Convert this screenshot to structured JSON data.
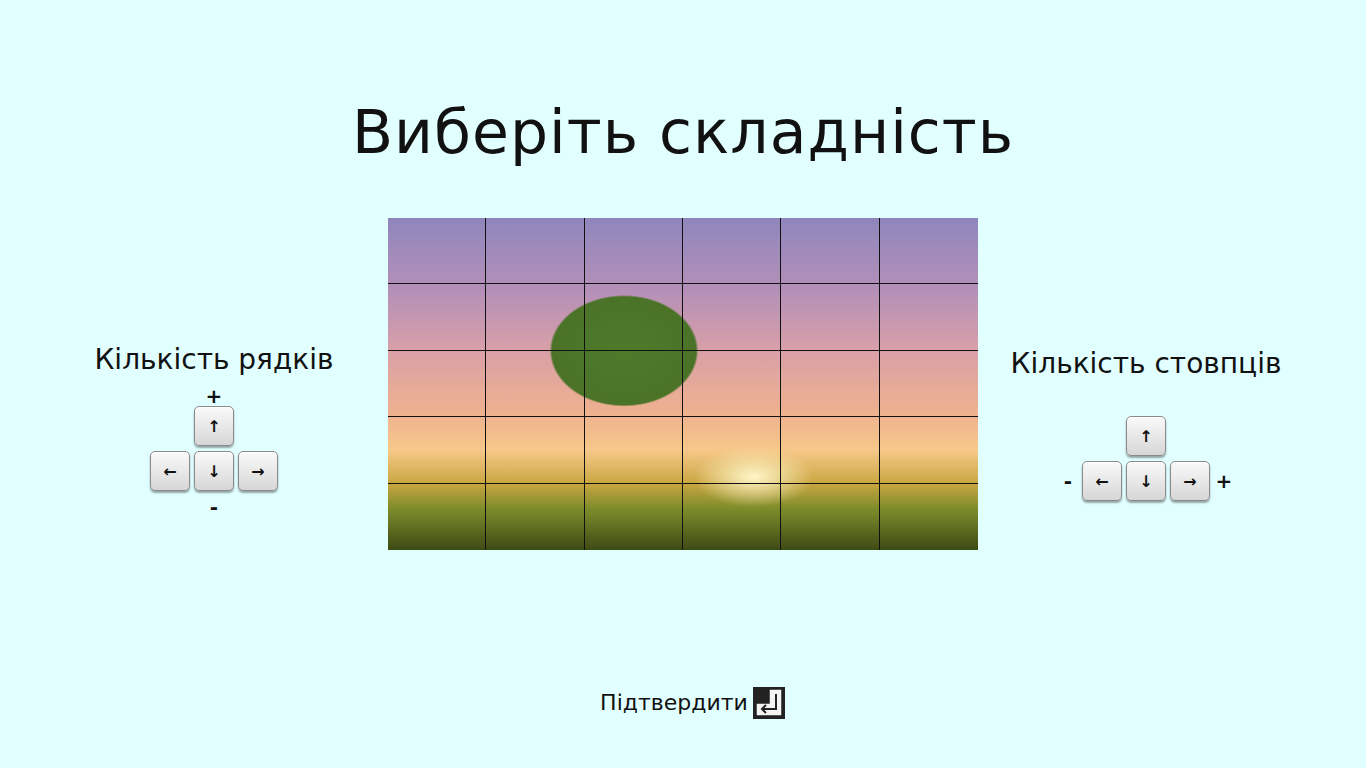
{
  "title": "Виберіть складність",
  "rows_control": {
    "label": "Кількість рядків",
    "plus": "+",
    "minus": "-",
    "keys": {
      "up": "↑",
      "left": "←",
      "down": "↓",
      "right": "→"
    }
  },
  "columns_control": {
    "label": "Кількість стовпців",
    "plus": "+",
    "minus": "-",
    "keys": {
      "up": "↑",
      "left": "←",
      "down": "↓",
      "right": "→"
    }
  },
  "preview": {
    "rows": 5,
    "columns": 6
  },
  "confirm": {
    "label": "Підтвердити"
  }
}
